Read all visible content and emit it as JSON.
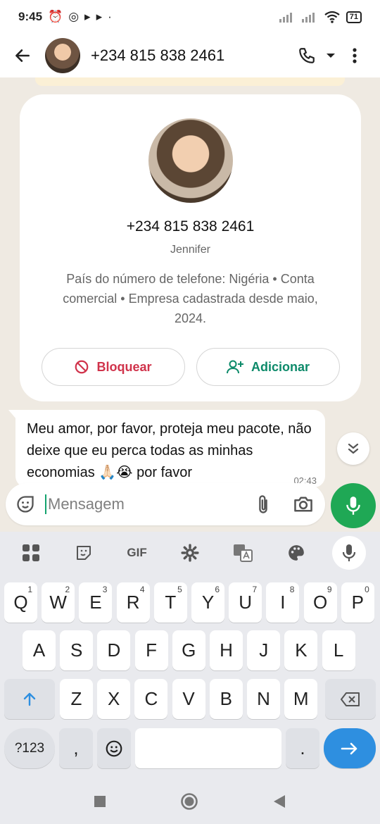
{
  "status": {
    "time": "9:45",
    "battery": "71"
  },
  "header": {
    "title": "+234 815 838 2461"
  },
  "contact_card": {
    "phone": "+234 815 838 2461",
    "name": "Jennifer",
    "info": "País do número de telefone: Nigéria • Conta comercial • Empresa cadastrada desde maio, 2024.",
    "block_label": "Bloquear",
    "add_label": "Adicionar"
  },
  "message": {
    "text": "Meu amor, por favor, proteja meu pacote, não deixe que eu perca todas as minhas economias 🙏🏻😭 por favor",
    "time": "02:43"
  },
  "composer": {
    "placeholder": "Mensagem"
  },
  "keyboard": {
    "toolbar": {
      "gif": "GIF"
    },
    "row1": [
      {
        "k": "Q",
        "n": "1"
      },
      {
        "k": "W",
        "n": "2"
      },
      {
        "k": "E",
        "n": "3"
      },
      {
        "k": "R",
        "n": "4"
      },
      {
        "k": "T",
        "n": "5"
      },
      {
        "k": "Y",
        "n": "6"
      },
      {
        "k": "U",
        "n": "7"
      },
      {
        "k": "I",
        "n": "8"
      },
      {
        "k": "O",
        "n": "9"
      },
      {
        "k": "P",
        "n": "0"
      }
    ],
    "row2": [
      "A",
      "S",
      "D",
      "F",
      "G",
      "H",
      "J",
      "K",
      "L"
    ],
    "row3": [
      "Z",
      "X",
      "C",
      "V",
      "B",
      "N",
      "M"
    ],
    "symbols_label": "?123",
    "comma": ",",
    "period": "."
  }
}
